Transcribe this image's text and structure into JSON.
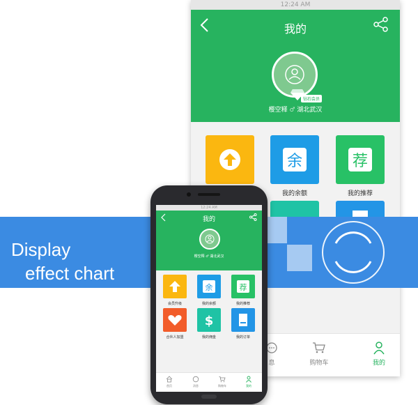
{
  "status_time": "12:24 AM",
  "header": {
    "title": "我的"
  },
  "user": {
    "name": "樱空释",
    "separator": "♂",
    "location": "湖北武汉",
    "vip_badge": "钻石会员"
  },
  "grid": [
    {
      "label": "会员升级",
      "color": "#fbb710",
      "icon": "arrow-up-icon"
    },
    {
      "label": "我的余额",
      "color": "#1e9ce6",
      "icon": "yu-character-icon",
      "glyph": "余"
    },
    {
      "label": "我的推荐",
      "color": "#28c166",
      "icon": "jian-character-icon",
      "glyph": "荐"
    },
    {
      "label": "合伙人加盟",
      "color": "#f25c2a",
      "icon": "handshake-heart-icon"
    },
    {
      "label": "我的佣金",
      "color": "#1fc3a5",
      "icon": "dollar-icon",
      "glyph": "$"
    },
    {
      "label": "我的订单",
      "color": "#2395e6",
      "icon": "document-icon"
    }
  ],
  "bottom_nav": [
    {
      "label": "首页",
      "icon": "home-icon"
    },
    {
      "label": "消息",
      "icon": "chat-icon"
    },
    {
      "label": "购物车",
      "icon": "cart-icon"
    },
    {
      "label": "我的",
      "icon": "user-icon",
      "active": true
    }
  ],
  "big_bottom_nav": [
    {
      "label": "息",
      "icon": "chat-icon"
    },
    {
      "label": "购物车",
      "icon": "cart-icon"
    },
    {
      "label": "我的",
      "icon": "user-icon",
      "active": true
    }
  ],
  "banner": {
    "line1": "Display",
    "line2": "effect chart",
    "color": "#3b8be2"
  },
  "colors": {
    "accent": "#27b35f"
  }
}
